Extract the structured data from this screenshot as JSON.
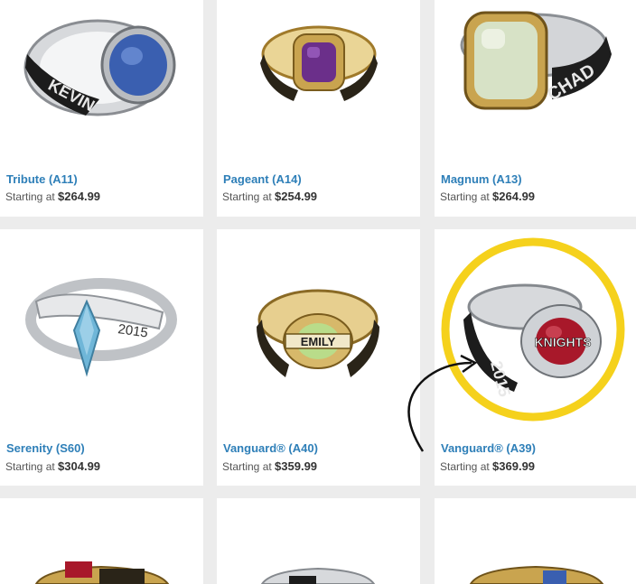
{
  "price_prefix": "Starting at",
  "colors": {
    "link": "#2e7fb8",
    "highlight": "#f5d11c",
    "page_bg": "#ececec"
  },
  "products": [
    {
      "name": "Tribute (A11)",
      "price": "$264.99",
      "stone": "#3a5fb0",
      "metal": "silver"
    },
    {
      "name": "Pageant (A14)",
      "price": "$254.99",
      "stone": "#6b2f8a",
      "metal": "gold"
    },
    {
      "name": "Magnum (A13)",
      "price": "$264.99",
      "stone": "#d7e2c6",
      "metal": "gold"
    },
    {
      "name": "Serenity (S60)",
      "price": "$304.99",
      "stone": "#6fb6d8",
      "metal": "silver"
    },
    {
      "name": "Vanguard® (A40)",
      "price": "$359.99",
      "stone": "#b9dc8a",
      "metal": "gold"
    },
    {
      "name": "Vanguard® (A39)",
      "price": "$369.99",
      "stone": "#a8182a",
      "metal": "silver"
    }
  ],
  "ring_engravings": {
    "tribute": "KEVIN",
    "magnum": "CHAD",
    "serenity_year": "2015",
    "vanguard_a40": "EMILY",
    "vanguard_a39": "KNIGHTS",
    "vanguard_a39_year": "2015"
  }
}
